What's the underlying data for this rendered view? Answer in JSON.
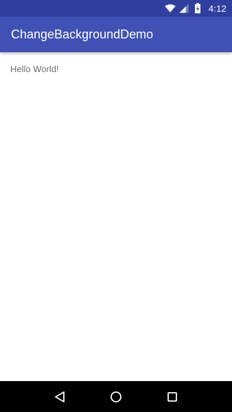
{
  "status_bar": {
    "time": "4:12",
    "icons": [
      "wifi-icon",
      "cell-signal-icon",
      "battery-icon"
    ],
    "background": "#303f9f"
  },
  "app_bar": {
    "title": "ChangeBackgroundDemo",
    "background": "#3f51b5"
  },
  "content": {
    "text": "Hello World!"
  },
  "nav_bar": {
    "buttons": [
      "back-icon",
      "home-icon",
      "recents-icon"
    ]
  }
}
